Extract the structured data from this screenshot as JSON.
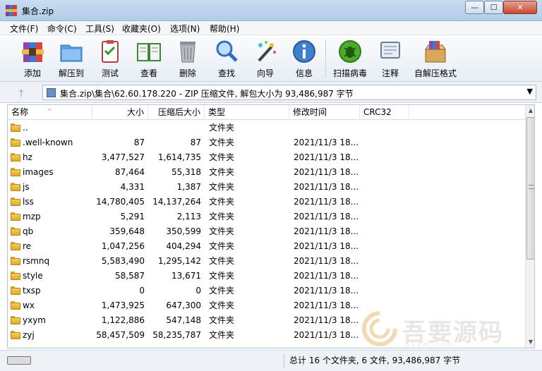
{
  "window": {
    "title": "集合.zip",
    "min_glyph": "—",
    "max_glyph": "☐",
    "close_glyph": "✕"
  },
  "menu": [
    "文件(F)",
    "命令(C)",
    "工具(S)",
    "收藏夹(O)",
    "选项(N)",
    "帮助(H)"
  ],
  "toolbar": [
    {
      "label": "添加",
      "icon": "add-archive-icon"
    },
    {
      "label": "解压到",
      "icon": "extract-to-folder-icon"
    },
    {
      "label": "测试",
      "icon": "test-clipboard-icon"
    },
    {
      "label": "查看",
      "icon": "view-book-icon"
    },
    {
      "label": "删除",
      "icon": "delete-trash-icon"
    },
    {
      "label": "查找",
      "icon": "find-magnifier-icon"
    },
    {
      "label": "向导",
      "icon": "wizard-wand-icon"
    },
    {
      "label": "信息",
      "icon": "info-icon"
    },
    {
      "label": "扫描病毒",
      "icon": "virus-scan-icon"
    },
    {
      "label": "注释",
      "icon": "comment-icon"
    },
    {
      "label": "自解压格式",
      "icon": "sfx-box-icon"
    }
  ],
  "address": {
    "up_glyph": "🡑",
    "path": "集合.zip\\集合\\62.60.178.220 - ZIP 压缩文件, 解包大小为 93,486,987 字节",
    "drop_glyph": "▼"
  },
  "columns": {
    "name": "名称",
    "size": "大小",
    "packed": "压缩后大小",
    "type": "类型",
    "modified": "修改时间",
    "crc": "CRC32",
    "sort_glyph": "^"
  },
  "files": [
    {
      "name": "..",
      "size": "",
      "packed": "",
      "type": "文件夹",
      "modified": ""
    },
    {
      "name": ".well-known",
      "size": "87",
      "packed": "87",
      "type": "文件夹",
      "modified": "2021/11/3 18..."
    },
    {
      "name": "hz",
      "size": "3,477,527",
      "packed": "1,614,735",
      "type": "文件夹",
      "modified": "2021/11/3 18..."
    },
    {
      "name": "images",
      "size": "87,464",
      "packed": "55,318",
      "type": "文件夹",
      "modified": "2021/11/3 18..."
    },
    {
      "name": "js",
      "size": "4,331",
      "packed": "1,387",
      "type": "文件夹",
      "modified": "2021/11/3 18..."
    },
    {
      "name": "lss",
      "size": "14,780,405",
      "packed": "14,137,264",
      "type": "文件夹",
      "modified": "2021/11/3 18..."
    },
    {
      "name": "mzp",
      "size": "5,291",
      "packed": "2,113",
      "type": "文件夹",
      "modified": "2021/11/3 18..."
    },
    {
      "name": "qb",
      "size": "359,648",
      "packed": "350,599",
      "type": "文件夹",
      "modified": "2021/11/3 18..."
    },
    {
      "name": "re",
      "size": "1,047,256",
      "packed": "404,294",
      "type": "文件夹",
      "modified": "2021/11/3 18..."
    },
    {
      "name": "rsmnq",
      "size": "5,583,490",
      "packed": "1,295,142",
      "type": "文件夹",
      "modified": "2021/11/3 18..."
    },
    {
      "name": "style",
      "size": "58,587",
      "packed": "13,671",
      "type": "文件夹",
      "modified": "2021/11/3 18..."
    },
    {
      "name": "txsp",
      "size": "0",
      "packed": "0",
      "type": "文件夹",
      "modified": "2021/11/3 18..."
    },
    {
      "name": "wx",
      "size": "1,473,925",
      "packed": "647,300",
      "type": "文件夹",
      "modified": "2021/11/3 18..."
    },
    {
      "name": "yxym",
      "size": "1,122,886",
      "packed": "547,148",
      "type": "文件夹",
      "modified": "2021/11/3 18..."
    },
    {
      "name": "zyj",
      "size": "58,457,509",
      "packed": "58,235,787",
      "type": "文件夹",
      "modified": "2021/11/3 18..."
    }
  ],
  "scrollbar": {
    "up_glyph": "▲",
    "down_glyph": "▼"
  },
  "status": {
    "summary": "总计 16 个文件夹, 6 文件, 93,486,987 字节"
  },
  "watermark": {
    "text": "吾要源码",
    "sub": "51ym.com"
  },
  "colors": {
    "folder": "#f5cd5b",
    "titlebar": "#c9dcf0",
    "close": "#c7472f"
  }
}
